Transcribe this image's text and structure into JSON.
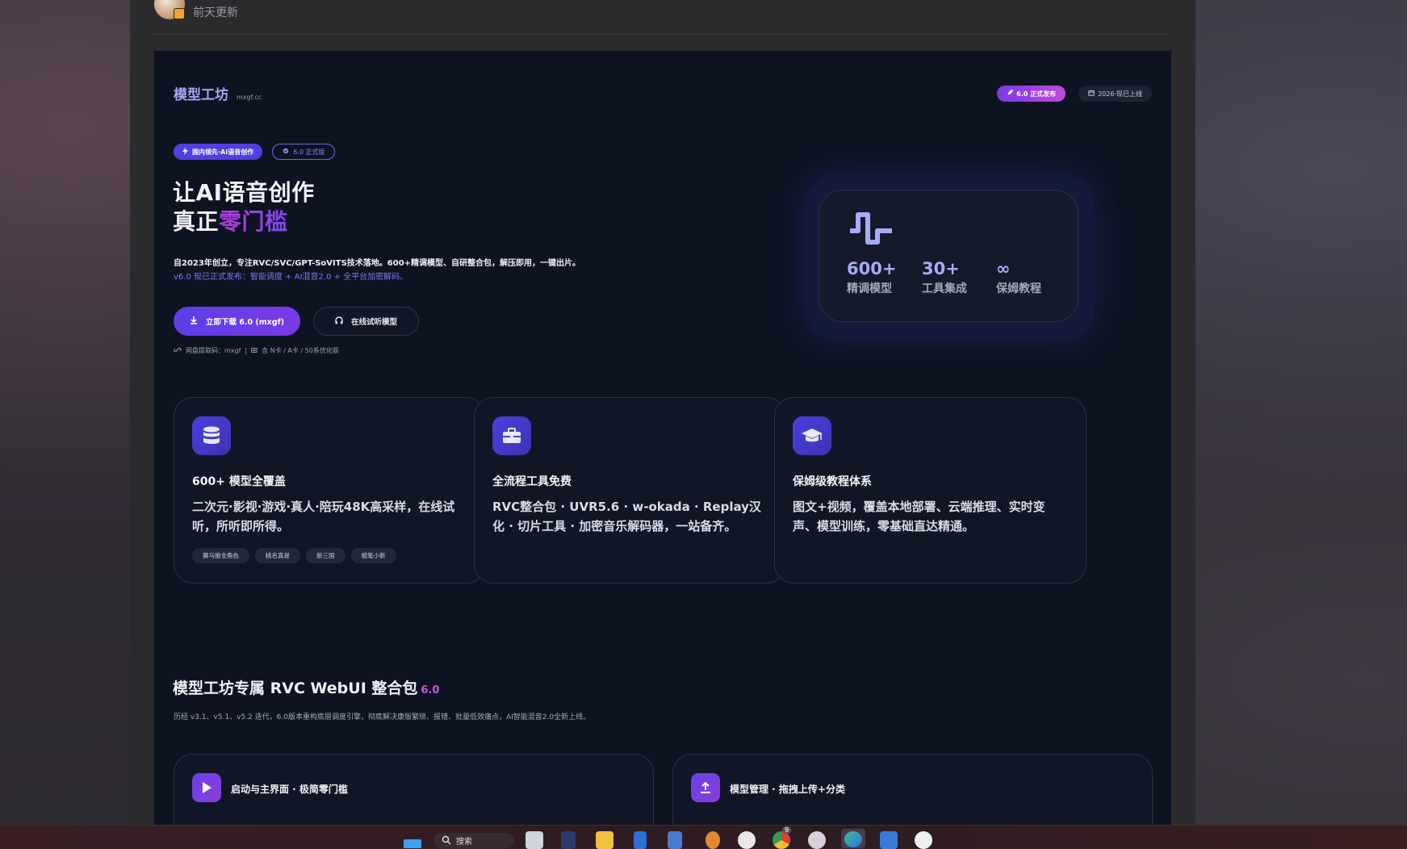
{
  "post": {
    "updated": "前天更新"
  },
  "site": {
    "brand_name": "模型工坊",
    "brand_domain": "mxgf.cc",
    "badge_release": "6.0 正式发布",
    "badge_date": "2026·现已上线"
  },
  "hero": {
    "pill_lead": "国内领先·AI语音创作",
    "pill_version": "6.0 正式版",
    "title_line1": "让AI语音创作",
    "title_line2_prefix": "真正",
    "title_line2_accent": "零门槛",
    "description": "自2023年创立，专注RVC/SVC/GPT-SoVITS技术落地。600+精调模型、自研整合包，解压即用，一键出片。",
    "news": "v6.0 现已正式发布：智能调度 + AI混音2.0 + 全平台加密解码。",
    "primary_button": "立即下载 6.0 (mxgf)",
    "secondary_button": "在线试听模型",
    "meta_link": "网盘提取码：mxgf",
    "meta_separator": "|",
    "meta_support": "含 N卡 / A卡 / 50系优化版"
  },
  "stats": [
    {
      "value": "600+",
      "label": "精调模型"
    },
    {
      "value": "30+",
      "label": "工具集成"
    },
    {
      "value": "∞",
      "label": "保姆教程"
    }
  ],
  "features": [
    {
      "icon": "database-icon",
      "title": "600+ 模型全覆盖",
      "desc": "二次元·影视·游戏·真人·陪玩48K高采样，在线试听，所听即所得。",
      "tags": [
        "赛马娘全角色",
        "桃名真是",
        "新三国",
        "蜡笔小新"
      ]
    },
    {
      "icon": "toolbox-icon",
      "title": "全流程工具免费",
      "desc": "RVC整合包 · UVR5.6 · w-okada · Replay汉化 · 切片工具 · 加密音乐解码器，一站备齐。",
      "tags": []
    },
    {
      "icon": "graduation-cap-icon",
      "title": "保姆级教程体系",
      "desc": "图文+视频，覆盖本地部署、云端推理、实时变声、模型训练，零基础直达精通。",
      "tags": []
    }
  ],
  "section": {
    "title": "模型工坊专属 RVC WebUI 整合包",
    "version": "6.0",
    "desc": "历经 v3.1、v5.1、v5.2 迭代，6.0版本重构底层调度引擎，彻底解决康版繁琐、报错、批量低效痛点，AI智能混音2.0全新上线。"
  },
  "bottom_cards": [
    {
      "icon": "play-icon",
      "title": "启动与主界面 · 极简零门槛"
    },
    {
      "icon": "upload-icon",
      "title": "模型管理 · 拖拽上传+分类"
    }
  ],
  "taskbar": {
    "search_label": "搜索",
    "notification_count": "9"
  },
  "colors": {
    "accent": "#5b3fe6",
    "accent_purple": "#b03ad8",
    "panel_bg": "#0e1322",
    "card_bg": "#111626"
  }
}
